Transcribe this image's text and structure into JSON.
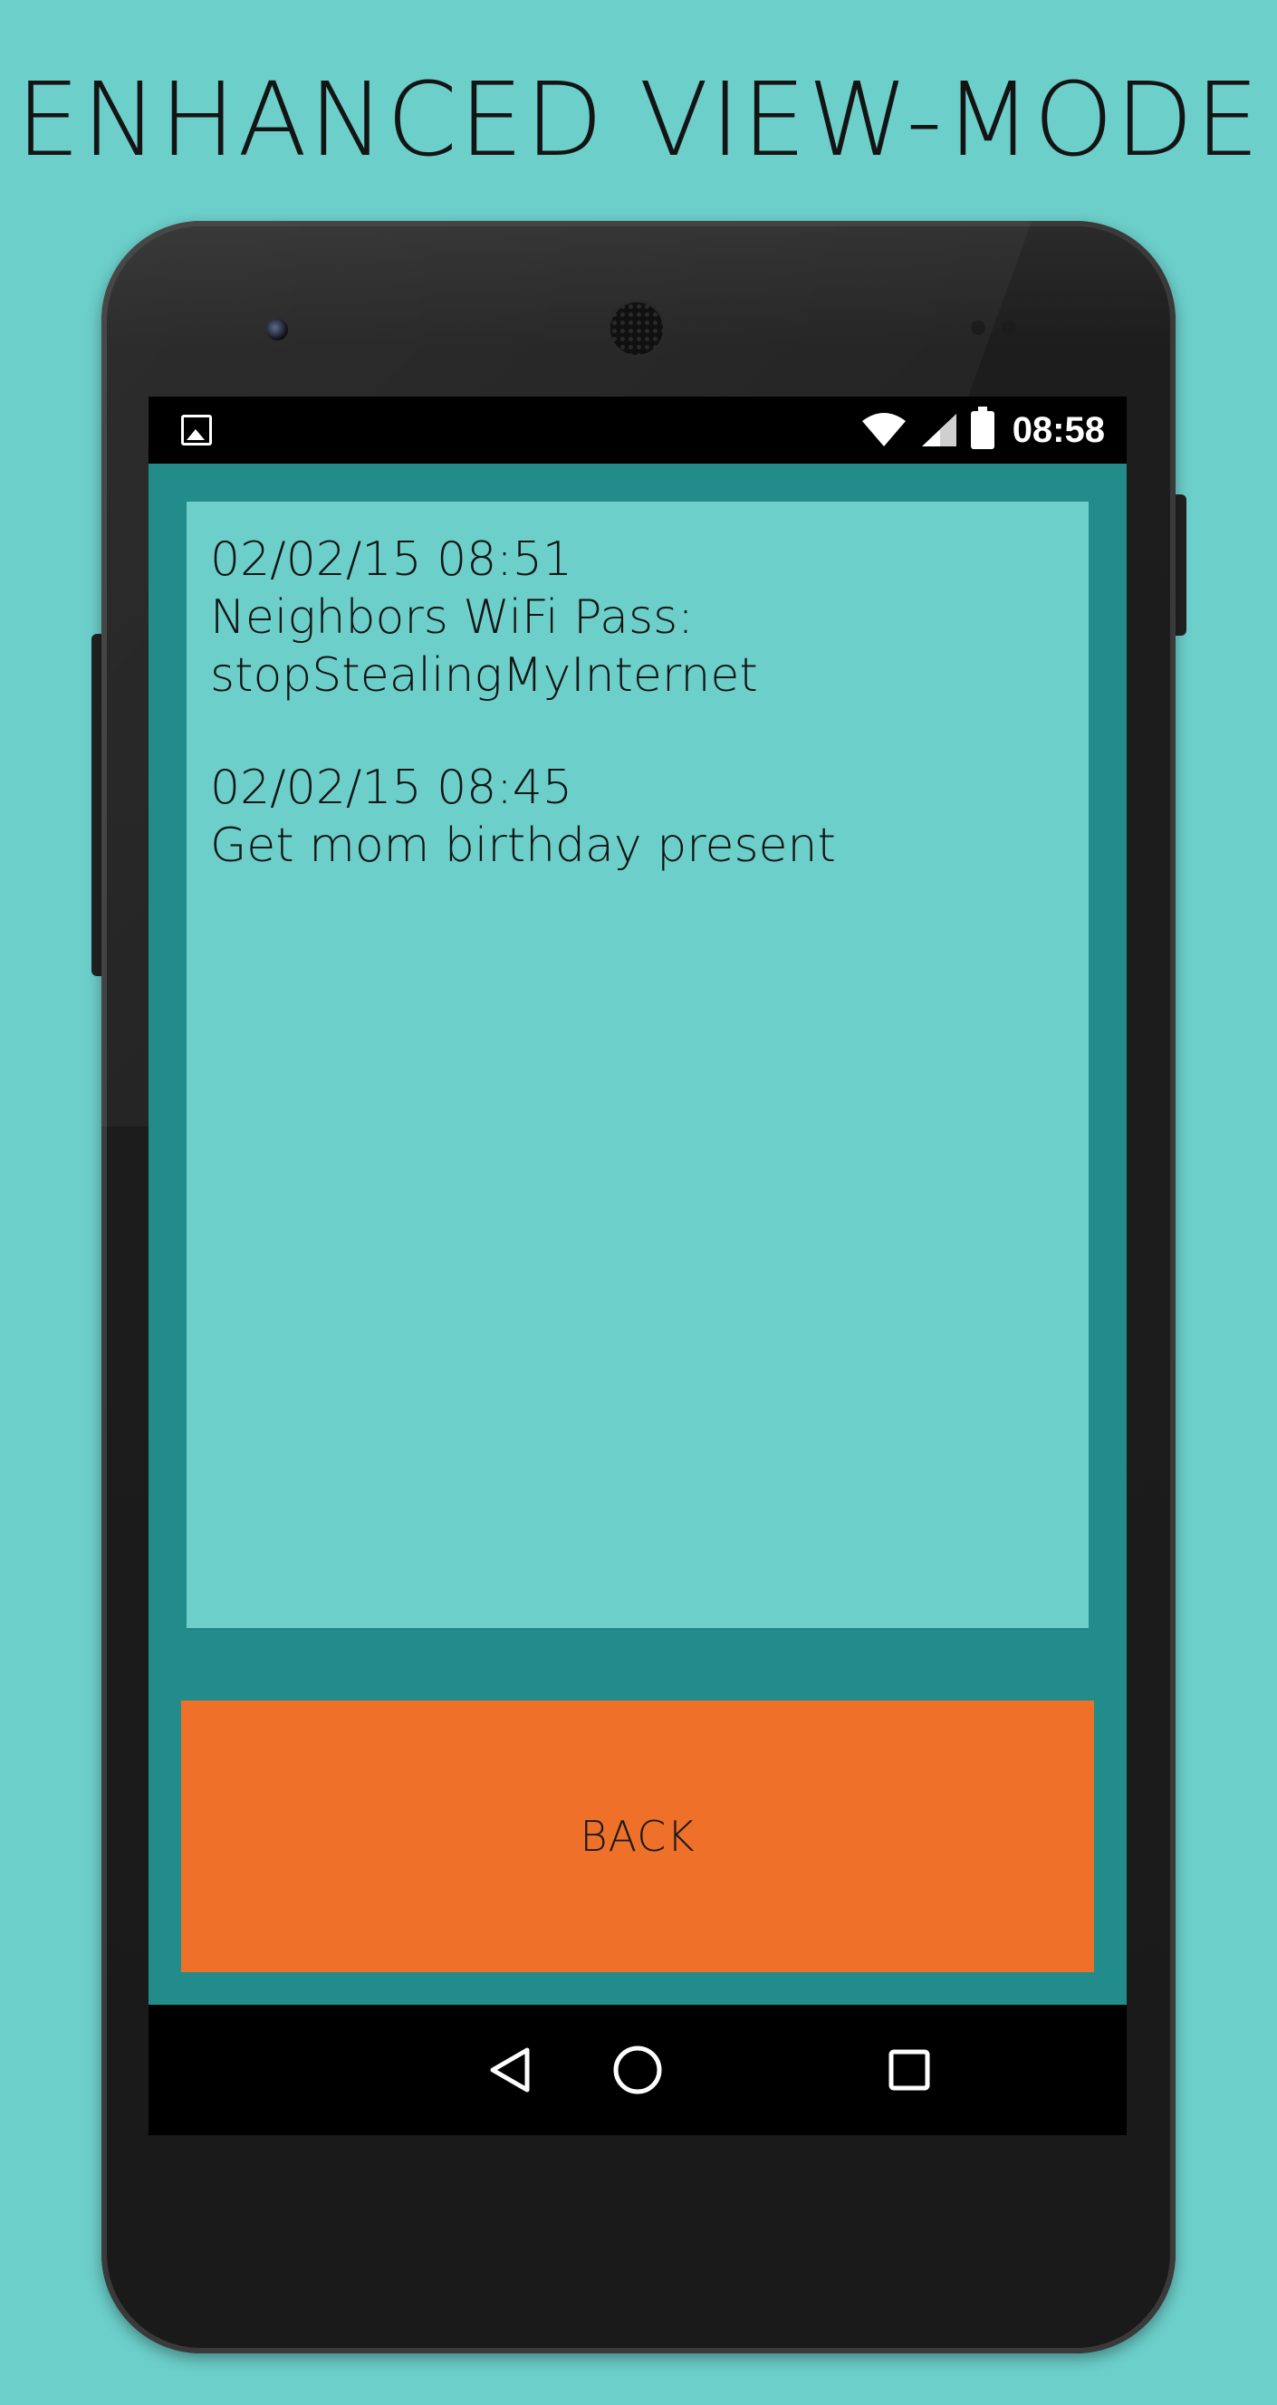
{
  "headline": "ENHANCED VIEW-MODE",
  "status_bar": {
    "time": "08:58",
    "icons": [
      "image-icon",
      "wifi-icon",
      "signal-icon",
      "battery-icon"
    ]
  },
  "notes": [
    {
      "timestamp": "02/02/15 08:51",
      "lines": [
        "Neighbors WiFi Pass:",
        "stopStealingMyInternet"
      ]
    },
    {
      "timestamp": "02/02/15 08:45",
      "lines": [
        "Get mom birthday present"
      ]
    }
  ],
  "back_button": {
    "label": "BACK"
  },
  "nav_bar": {
    "icons": [
      "back-triangle-icon",
      "home-circle-icon",
      "recents-square-icon"
    ]
  },
  "colors": {
    "background": "#6ccfca",
    "app_frame": "#218c8a",
    "notes_panel": "#6ccfca",
    "back_button": "#ee7029"
  }
}
